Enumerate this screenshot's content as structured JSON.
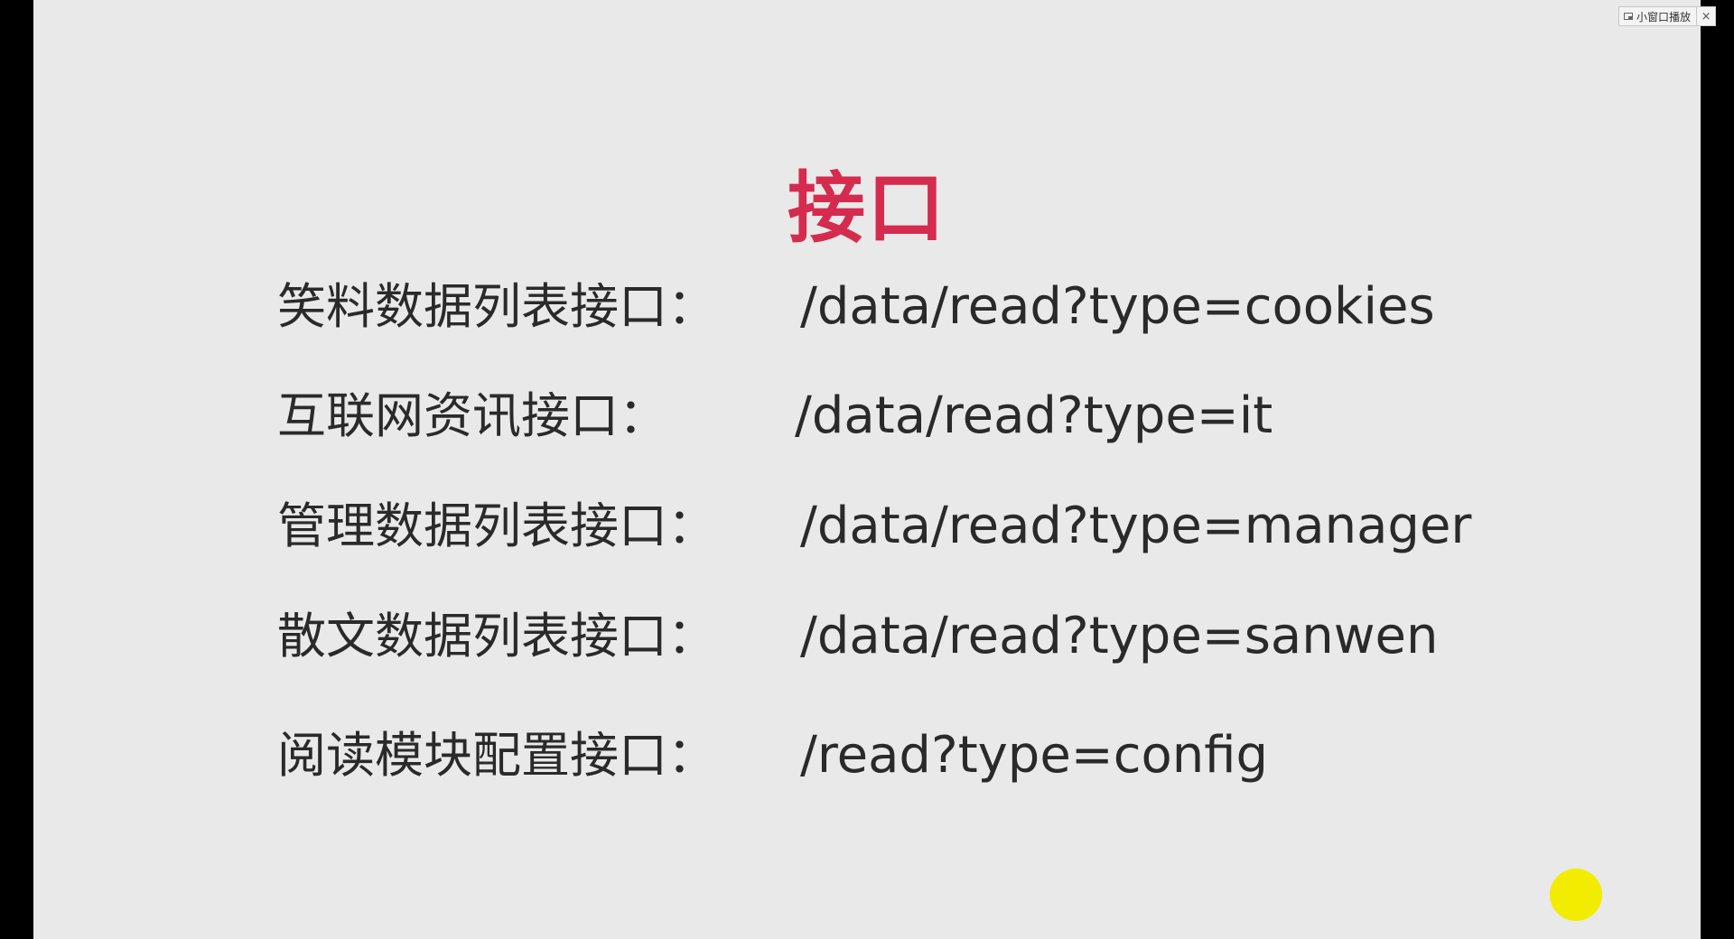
{
  "slide": {
    "title": "接口",
    "title_color": "#d42b4e",
    "background_color": "#e9e9e9",
    "apis": [
      {
        "label": "笑料数据列表接口：",
        "path": "/data/read?type=cookies"
      },
      {
        "label": "互联网资讯接口：",
        "path": "/data/read?type=it"
      },
      {
        "label": "管理数据列表接口：",
        "path": "/data/read?type=manager"
      },
      {
        "label": "散文数据列表接口：",
        "path": "/data/read?type=sanwen"
      },
      {
        "label": "阅读模块配置接口：",
        "path": "/read?type=config"
      }
    ]
  },
  "mini_player": {
    "label": "小窗口播放",
    "icon": "mini-window-icon",
    "close_symbol": "×",
    "close_icon": "close-icon"
  },
  "cursor_highlight": {
    "color": "#f2ec00"
  }
}
